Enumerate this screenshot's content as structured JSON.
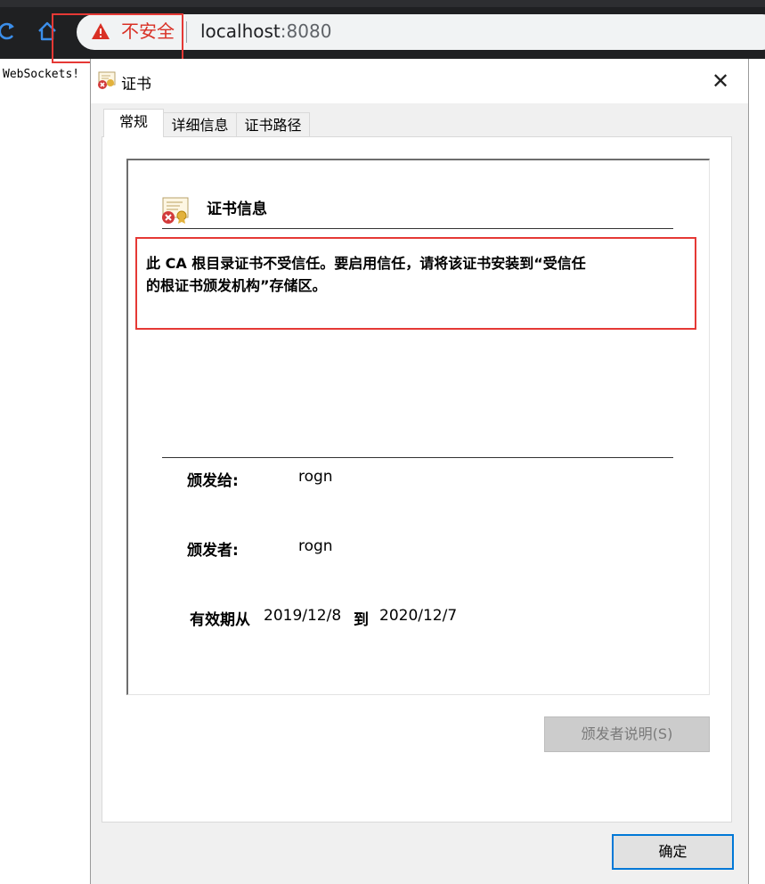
{
  "browser": {
    "security_label": "不安全",
    "url_host": "localhost",
    "url_port": ":8080"
  },
  "page": {
    "body_text": "WebSockets!"
  },
  "dialog": {
    "title": "证书",
    "tabs": [
      {
        "label": "常规",
        "active": true
      },
      {
        "label": "详细信息",
        "active": false
      },
      {
        "label": "证书路径",
        "active": false
      }
    ],
    "info_title": "证书信息",
    "warning_line1": "此 CA 根目录证书不受信任。要启用信任，请将该证书安装到“受信任",
    "warning_line2": "的根证书颁发机构”存储区。",
    "issued_to_label": "颁发给:",
    "issued_to_value": "rogn",
    "issued_by_label": "颁发者:",
    "issued_by_value": "rogn",
    "validity_label": "有效期从",
    "valid_from": "2019/12/8",
    "to_label": "到",
    "valid_to": "2020/12/7",
    "issuer_statement_button": "颁发者说明(S)",
    "ok_button": "确定"
  },
  "icons": {
    "reload": "reload-icon",
    "home": "home-icon",
    "warning": "warning-triangle-icon",
    "certificate": "certificate-error-icon",
    "close": "close-icon"
  },
  "colors": {
    "highlight": "#e53935",
    "not_secure": "#d93025",
    "focus": "#0078d7"
  }
}
